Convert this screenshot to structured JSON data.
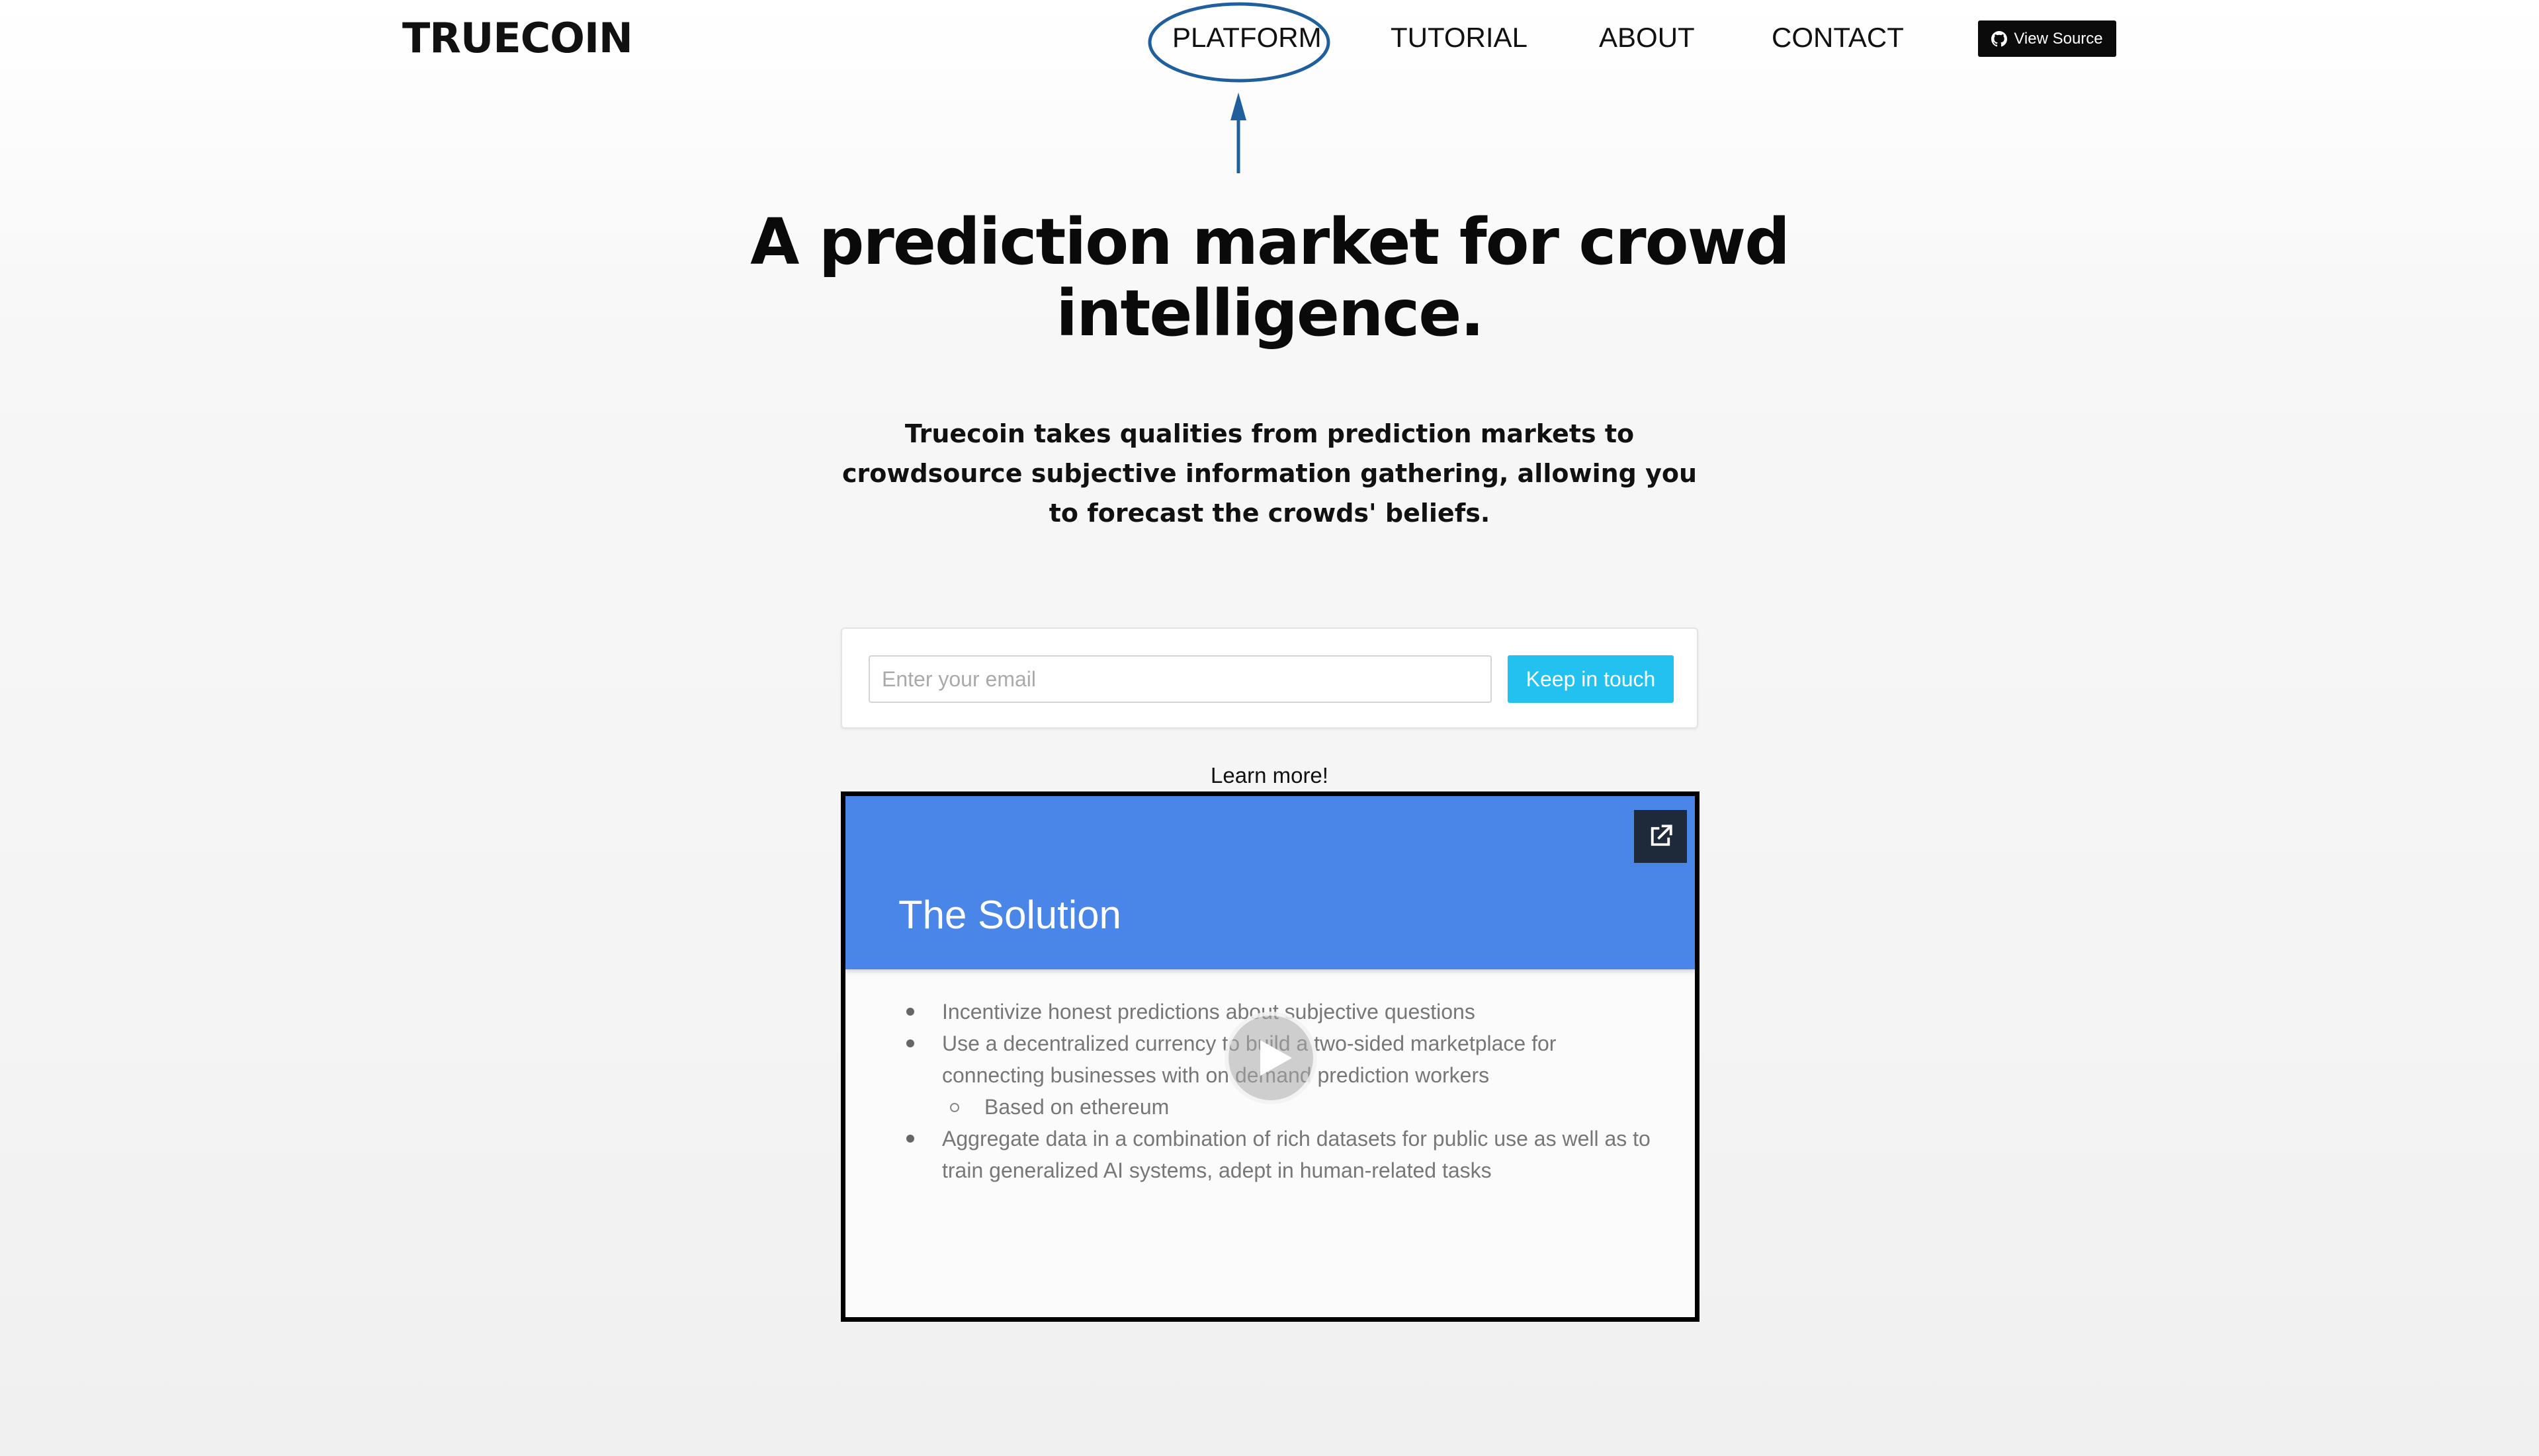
{
  "nav": {
    "brand": "TRUECOIN",
    "links": [
      {
        "label": "PLATFORM"
      },
      {
        "label": "TUTORIAL"
      },
      {
        "label": "ABOUT"
      },
      {
        "label": "CONTACT"
      }
    ],
    "view_source_label": "View Source",
    "view_source_icon": "github-icon"
  },
  "annotation": {
    "highlighted_item": "PLATFORM",
    "color": "#1f5f9e"
  },
  "hero": {
    "title": "A prediction market for crowd intelligence.",
    "description": "Truecoin takes qualities from prediction markets to crowdsource subjective information gathering, allowing you to forecast the crowds' beliefs."
  },
  "signup": {
    "email_placeholder": "Enter your email",
    "email_value": "",
    "button_label": "Keep in touch",
    "button_color": "#23c1ef"
  },
  "video": {
    "caption": "Learn more!",
    "slide_title": "The Solution",
    "header_color": "#4a86e8",
    "bullets": [
      "Incentivize honest predictions about subjective questions",
      "Use a decentralized currency to build a two-sided marketplace for connecting businesses with on demand prediction workers",
      "Based on ethereum",
      "Aggregate data in a combination of rich datasets for public use as well as to train generalized AI systems, adept in human-related tasks"
    ],
    "popout_icon": "external-link-icon",
    "play_icon": "play-icon"
  }
}
